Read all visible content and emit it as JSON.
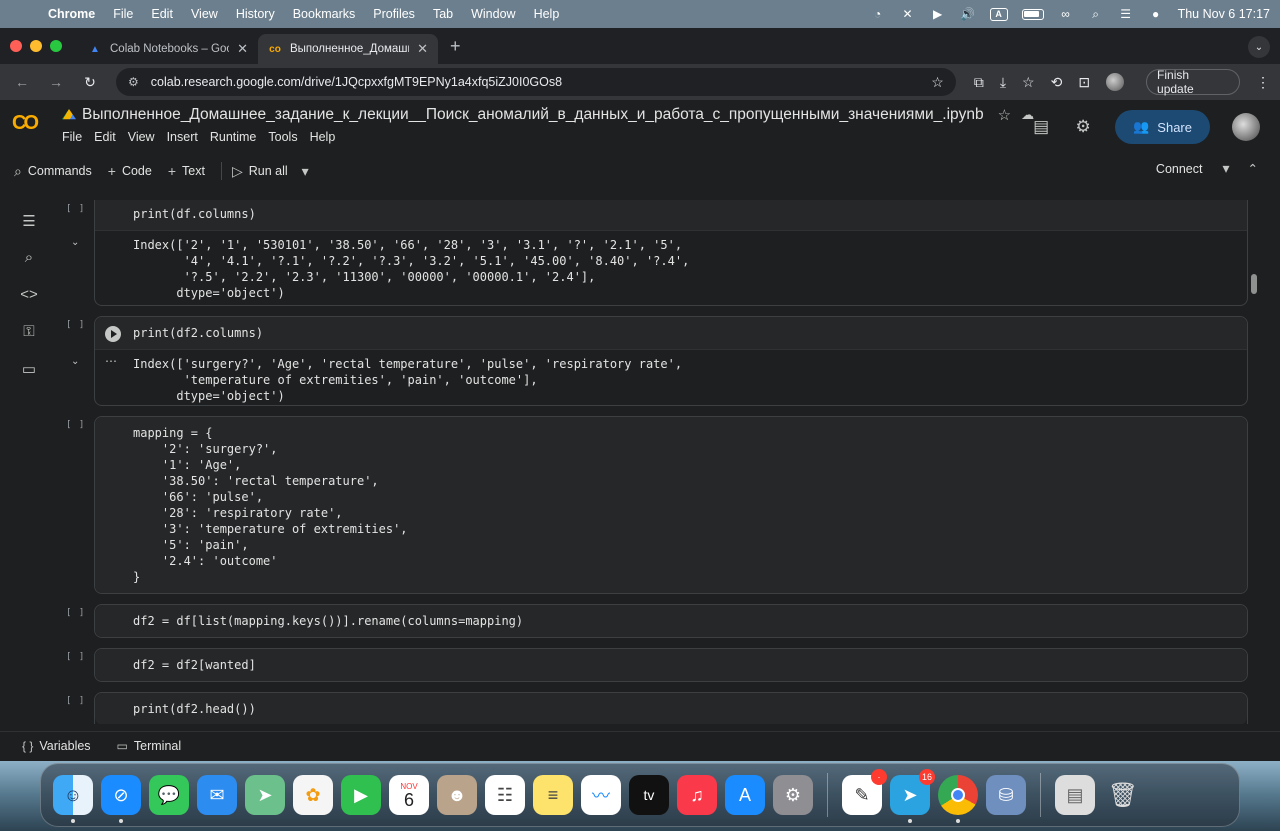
{
  "menubar": {
    "app": "Chrome",
    "items": [
      "File",
      "Edit",
      "View",
      "History",
      "Bookmarks",
      "Profiles",
      "Tab",
      "Window",
      "Help"
    ],
    "datetime": "Thu Nov 6  17:17",
    "input_badge": "A"
  },
  "tabs": [
    {
      "title": "Colab Notebooks – Google Д",
      "icon": "google-drive-icon"
    },
    {
      "title": "Выполненное_Домашнее_з",
      "icon": "colab-icon"
    }
  ],
  "omnibox": {
    "url": "colab.research.google.com/drive/1JQcpxxfgMT9EPNy1a4xfq5iZJ0I0GOs8"
  },
  "browser_toolbar": {
    "finish_update": "Finish update"
  },
  "colab": {
    "logo": "CO",
    "title": "Выполненное_Домашнее_задание_к_лекции__Поиск_аномалий_в_данных_и_работа_с_пропущенными_значениями_.ipynb",
    "menu": [
      "File",
      "Edit",
      "View",
      "Insert",
      "Runtime",
      "Tools",
      "Help"
    ],
    "share_label": "Share",
    "toolbar": {
      "commands": "Commands",
      "code": "Code",
      "text": "Text",
      "run_all": "Run all",
      "connect": "Connect"
    }
  },
  "cells": [
    {
      "bracket": "[ ]",
      "code": "print(df.columns)",
      "output": "Index(['2', '1', '530101', '38.50', '66', '28', '3', '3.1', '?', '2.1', '5',\n       '4', '4.1', '?.1', '?.2', '?.3', '3.2', '5.1', '45.00', '8.40', '?.4',\n       '?.5', '2.2', '2.3', '11300', '00000', '00000.1', '2.4'],\n      dtype='object')"
    },
    {
      "bracket": "[ ]",
      "code": "print(df2.columns)",
      "output": "Index(['surgery?', 'Age', 'rectal temperature', 'pulse', 'respiratory rate',\n       'temperature of extremities', 'pain', 'outcome'],\n      dtype='object')"
    },
    {
      "bracket": "[ ]",
      "code": "mapping = {\n    '2': 'surgery?',\n    '1': 'Age',\n    '38.50': 'rectal temperature',\n    '66': 'pulse',\n    '28': 'respiratory rate',\n    '3': 'temperature of extremities',\n    '5': 'pain',\n    '2.4': 'outcome'\n}"
    },
    {
      "bracket": "[ ]",
      "code": "df2 = df[list(mapping.keys())].rename(columns=mapping)"
    },
    {
      "bracket": "[ ]",
      "code": "df2 = df2[wanted]"
    },
    {
      "bracket": "[ ]",
      "code": "print(df2.head())"
    }
  ],
  "statusbar": {
    "variables": "Variables",
    "terminal": "Terminal"
  },
  "dock": {
    "calendar_month": "NOV",
    "calendar_day": "6",
    "tv_label": "tv",
    "badge_1": "·",
    "badge_2": "16"
  }
}
